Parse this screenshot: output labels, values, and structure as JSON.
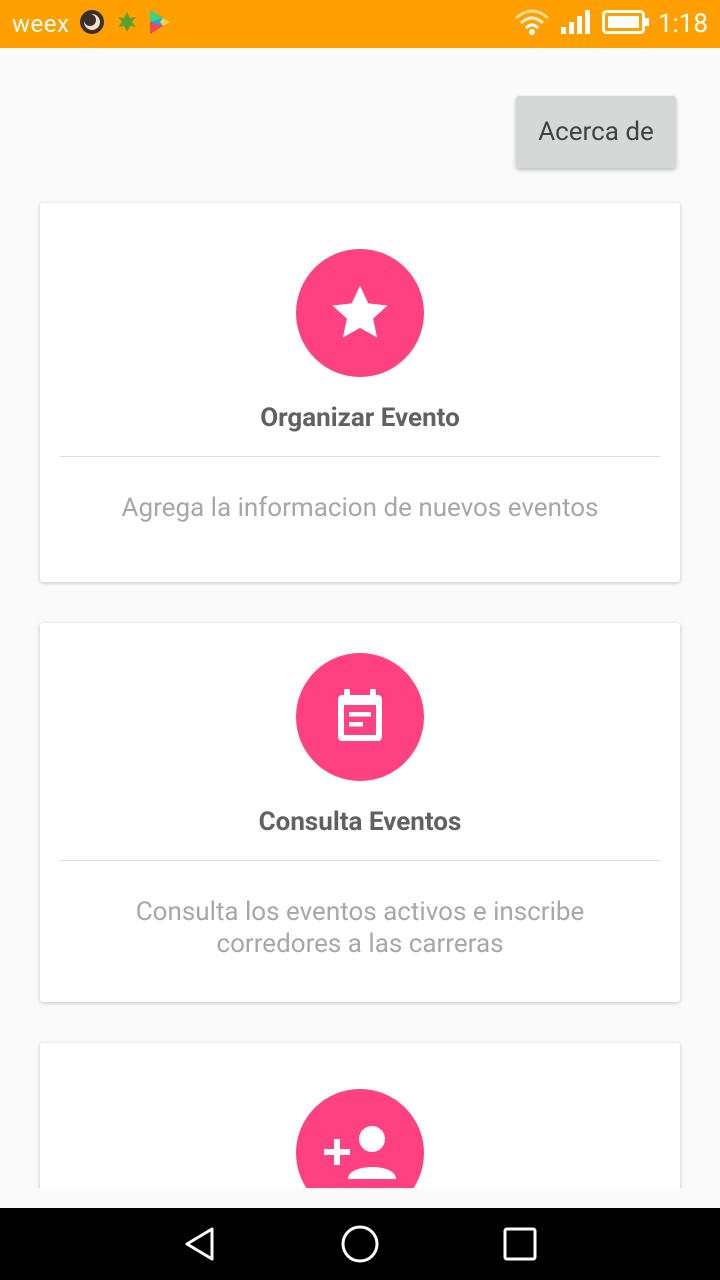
{
  "status_bar": {
    "carrier": "weex",
    "time": "1:18",
    "icons": [
      "weex-app-icon",
      "leaf-icon",
      "play-store-icon",
      "wifi-icon",
      "signal-icon",
      "battery-icon"
    ],
    "background": "#ffa000"
  },
  "toolbar": {
    "about_label": "Acerca de"
  },
  "cards": [
    {
      "icon": "star-icon",
      "title": "Organizar Evento",
      "description": "Agrega la informacion de nuevos eventos"
    },
    {
      "icon": "event-note-icon",
      "title": "Consulta Eventos",
      "description": "Consulta los eventos activos e inscribe corredores a las carreras"
    },
    {
      "icon": "person-add-icon"
    }
  ],
  "colors": {
    "accent": "#ff4081",
    "title_text": "#616161",
    "description_text": "#a7a7a7"
  },
  "nav_bar": {
    "buttons": [
      "back-icon",
      "home-icon",
      "recents-icon"
    ]
  }
}
